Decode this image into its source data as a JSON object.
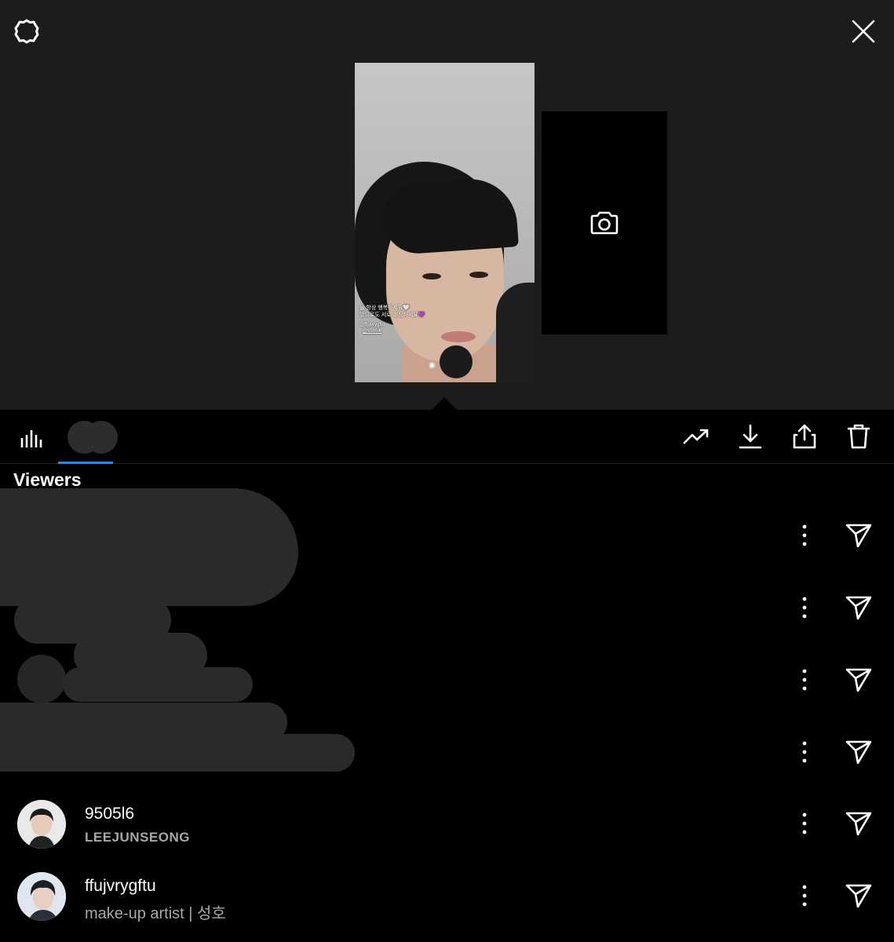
{
  "icons": {
    "settings": "gear-icon",
    "close": "close-icon",
    "insights": "bar-chart-icon",
    "boost": "trending-up-icon",
    "download": "download-icon",
    "share": "share-icon",
    "delete": "trash-icon",
    "add_story": "camera-icon",
    "more": "vertical-dots-icon",
    "send": "send-icon"
  },
  "story": {
    "caption_line1": "늘 항상 행복하세요🤍",
    "caption_line2": "앞으로도 서로 조심하세요💜",
    "mention_name": "@ffujvrygftu",
    "mention_tag": "@9505l6"
  },
  "viewers": {
    "title": "Viewers",
    "list": [
      {
        "username": "9505l6",
        "subtitle": "LEEJUNSEONG"
      },
      {
        "username": "ffujvrygftu",
        "subtitle": "make-up artist | 성호"
      }
    ]
  },
  "colors": {
    "background": "#000000",
    "top_background": "#1c1c1c",
    "tab_underline": "#2f86e8",
    "secondary_text": "#a8a8a8"
  }
}
